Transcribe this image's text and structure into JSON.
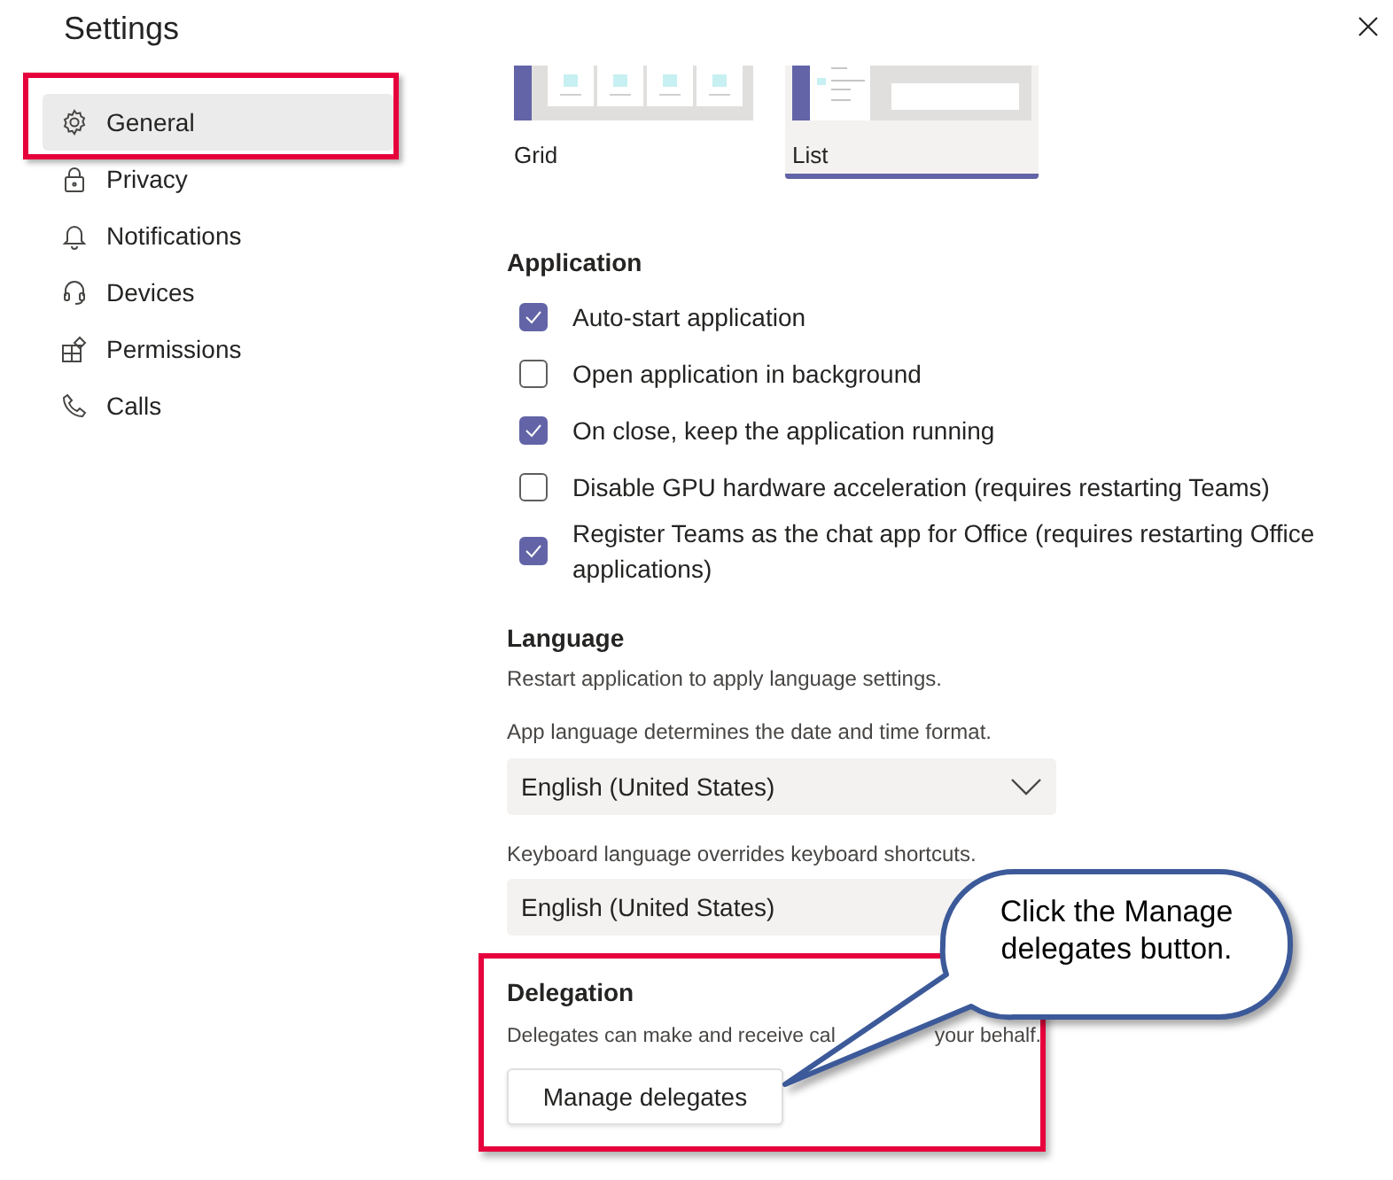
{
  "window": {
    "title": "Settings"
  },
  "sidebar": {
    "items": [
      {
        "label": "General",
        "kind": "gear",
        "selected": true,
        "highlighted": true
      },
      {
        "label": "Privacy",
        "kind": "lock",
        "selected": false,
        "highlighted": false
      },
      {
        "label": "Notifications",
        "kind": "bell",
        "selected": false,
        "highlighted": false
      },
      {
        "label": "Devices",
        "kind": "headset",
        "selected": false,
        "highlighted": false
      },
      {
        "label": "Permissions",
        "kind": "apps",
        "selected": false,
        "highlighted": false
      },
      {
        "label": "Calls",
        "kind": "phone",
        "selected": false,
        "highlighted": false
      }
    ]
  },
  "layout_options": [
    {
      "label": "Grid",
      "kind": "grid",
      "selected": false
    },
    {
      "label": "List",
      "kind": "list",
      "selected": true
    }
  ],
  "application": {
    "heading": "Application",
    "options": [
      {
        "label": "Auto-start application",
        "checked": true
      },
      {
        "label": "Open application in background",
        "checked": false
      },
      {
        "label": "On close, keep the application running",
        "checked": true
      },
      {
        "label": "Disable GPU hardware acceleration (requires restarting Teams)",
        "checked": false
      },
      {
        "label": "Register Teams as the chat app for Office (requires restarting Office applications)",
        "checked": true
      }
    ]
  },
  "language": {
    "heading": "Language",
    "note": "Restart application to apply language settings.",
    "fields": [
      {
        "label": "App language determines the date and time format.",
        "value": "English (United States)",
        "chevron": true
      },
      {
        "label": "Keyboard language overrides keyboard shortcuts.",
        "value": "English (United States)"
      }
    ]
  },
  "delegation": {
    "heading": "Delegation",
    "highlighted": true,
    "description_parts": [
      "Delegates can make and receive cal",
      "your behalf."
    ],
    "button": "Manage delegates"
  },
  "callout": {
    "text": "Click the Manage delegates button."
  }
}
